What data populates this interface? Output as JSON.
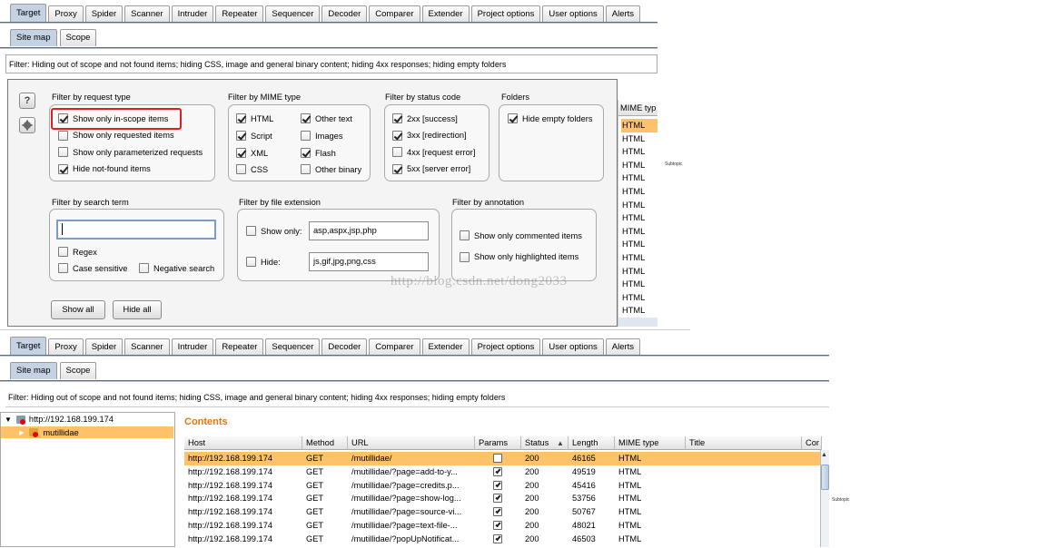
{
  "tabs": [
    "Target",
    "Proxy",
    "Spider",
    "Scanner",
    "Intruder",
    "Repeater",
    "Sequencer",
    "Decoder",
    "Comparer",
    "Extender",
    "Project options",
    "User options",
    "Alerts"
  ],
  "subtabs": [
    "Site map",
    "Scope"
  ],
  "filter_text": "Filter:  Hiding out of scope and not found items;  hiding CSS, image and general binary content;  hiding 4xx responses;  hiding empty folders",
  "panel": {
    "help_icon": "?",
    "request_type": {
      "title": "Filter by request type",
      "items": [
        {
          "label": "Show only in-scope items",
          "checked": true,
          "highlighted": true
        },
        {
          "label": "Show only requested items",
          "checked": false
        },
        {
          "label": "Show only parameterized requests",
          "checked": false
        },
        {
          "label": "Hide not-found items",
          "checked": true
        }
      ]
    },
    "mime": {
      "title": "Filter by MIME type",
      "items": [
        {
          "label": "HTML",
          "checked": true
        },
        {
          "label": "Other text",
          "checked": true
        },
        {
          "label": "Script",
          "checked": true
        },
        {
          "label": "Images",
          "checked": false
        },
        {
          "label": "XML",
          "checked": true
        },
        {
          "label": "Flash",
          "checked": true
        },
        {
          "label": "CSS",
          "checked": false
        },
        {
          "label": "Other binary",
          "checked": false
        }
      ]
    },
    "status": {
      "title": "Filter by status code",
      "items": [
        {
          "label": "2xx  [success]",
          "checked": true
        },
        {
          "label": "3xx  [redirection]",
          "checked": true
        },
        {
          "label": "4xx  [request error]",
          "checked": false
        },
        {
          "label": "5xx  [server error]",
          "checked": true
        }
      ]
    },
    "folders": {
      "title": "Folders",
      "items": [
        {
          "label": "Hide empty folders",
          "checked": true
        }
      ]
    },
    "search": {
      "title": "Filter by search term",
      "value": "",
      "items": [
        {
          "label": "Regex",
          "checked": false
        },
        {
          "label": "Case sensitive",
          "checked": false
        },
        {
          "label": "Negative search",
          "checked": false
        }
      ]
    },
    "extension": {
      "title": "Filter by file extension",
      "show_only": {
        "label": "Show only:",
        "checked": false,
        "value": "asp,aspx,jsp,php"
      },
      "hide": {
        "label": "Hide:",
        "checked": false,
        "value": "js,gif,jpg,png,css"
      }
    },
    "annotation": {
      "title": "Filter by annotation",
      "items": [
        {
          "label": "Show only commented items",
          "checked": false
        },
        {
          "label": "Show only highlighted items",
          "checked": false
        }
      ]
    },
    "buttons": {
      "show_all": "Show all",
      "hide_all": "Hide all"
    }
  },
  "behind_mime": {
    "header": "MIME typ",
    "values": [
      "HTML",
      "HTML",
      "HTML",
      "HTML",
      "HTML",
      "HTML",
      "HTML",
      "HTML",
      "HTML",
      "HTML",
      "HTML",
      "HTML",
      "HTML",
      "HTML",
      "HTML"
    ]
  },
  "watermark": "http://blog.csdn.net/dong2033",
  "subtopic_labels": [
    "Subtopic",
    "Subtopic"
  ],
  "tree": [
    {
      "label": "http://192.168.199.174",
      "expanded": true
    },
    {
      "label": "mutillidae",
      "selected": true
    }
  ],
  "contents_title": "Contents",
  "table": {
    "columns": [
      "Host",
      "Method",
      "URL",
      "Params",
      "Status",
      "Length",
      "MIME type",
      "Title",
      "Cor"
    ],
    "sort_column": "Status",
    "rows": [
      {
        "host": "http://192.168.199.174",
        "method": "GET",
        "url": "/mutillidae/",
        "params": false,
        "status": "200",
        "length": "46165",
        "mime": "HTML",
        "selected": true
      },
      {
        "host": "http://192.168.199.174",
        "method": "GET",
        "url": "/mutillidae/?page=add-to-y...",
        "params": true,
        "status": "200",
        "length": "49519",
        "mime": "HTML"
      },
      {
        "host": "http://192.168.199.174",
        "method": "GET",
        "url": "/mutillidae/?page=credits.p...",
        "params": true,
        "status": "200",
        "length": "45416",
        "mime": "HTML"
      },
      {
        "host": "http://192.168.199.174",
        "method": "GET",
        "url": "/mutillidae/?page=show-log...",
        "params": true,
        "status": "200",
        "length": "53756",
        "mime": "HTML"
      },
      {
        "host": "http://192.168.199.174",
        "method": "GET",
        "url": "/mutillidae/?page=source-vi...",
        "params": true,
        "status": "200",
        "length": "50767",
        "mime": "HTML"
      },
      {
        "host": "http://192.168.199.174",
        "method": "GET",
        "url": "/mutillidae/?page=text-file-...",
        "params": true,
        "status": "200",
        "length": "48021",
        "mime": "HTML"
      },
      {
        "host": "http://192.168.199.174",
        "method": "GET",
        "url": "/mutillidae/?popUpNotificat...",
        "params": true,
        "status": "200",
        "length": "46503",
        "mime": "HTML"
      }
    ]
  },
  "colors": {
    "accent": "#e8760a",
    "selection": "#ffc16a",
    "highlight_box": "#e02020",
    "tab_active": "#c4d2e4"
  }
}
